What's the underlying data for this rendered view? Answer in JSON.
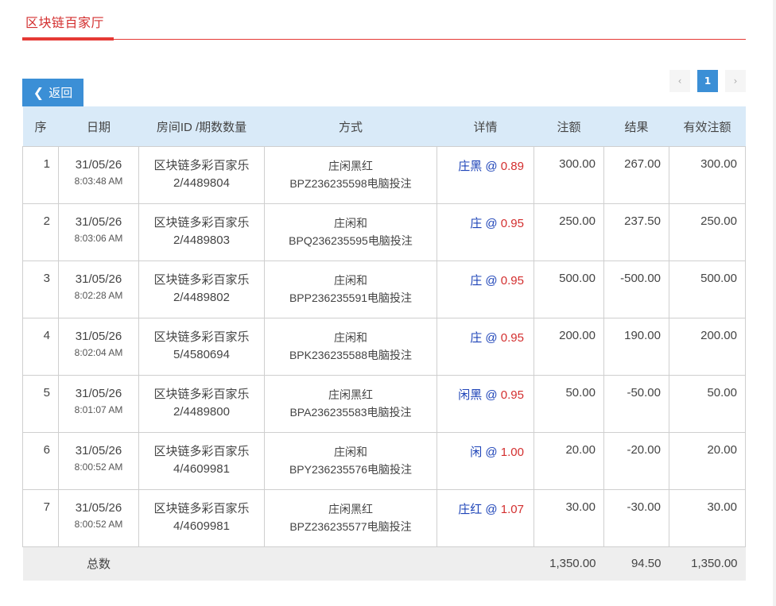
{
  "header": {
    "title": "区块链百家厅"
  },
  "toolbar": {
    "back_label": "返回",
    "back_icon": "chevron-left-icon"
  },
  "pagination": {
    "prev": "‹",
    "current": "1",
    "next": "›"
  },
  "table": {
    "columns": [
      "序",
      "日期",
      "房间ID /期数数量",
      "方式",
      "详情",
      "注额",
      "结果",
      "有效注额"
    ],
    "rows": [
      {
        "seq": "1",
        "date": "31/05/26",
        "time": "8:03:48 AM",
        "room": "区块链多彩百家乐",
        "round": "2/4489804",
        "mode": "庄闲黑红",
        "code": "BPZ236235598电脑投注",
        "selection": "庄黑",
        "at": "@",
        "odds": "0.89",
        "amount": "300.00",
        "result": "267.00",
        "result_sign": "pos",
        "valid": "300.00"
      },
      {
        "seq": "2",
        "date": "31/05/26",
        "time": "8:03:06 AM",
        "room": "区块链多彩百家乐",
        "round": "2/4489803",
        "mode": "庄闲和",
        "code": "BPQ236235595电脑投注",
        "selection": "庄",
        "at": "@",
        "odds": "0.95",
        "amount": "250.00",
        "result": "237.50",
        "result_sign": "pos",
        "valid": "250.00"
      },
      {
        "seq": "3",
        "date": "31/05/26",
        "time": "8:02:28 AM",
        "room": "区块链多彩百家乐",
        "round": "2/4489802",
        "mode": "庄闲和",
        "code": "BPP236235591电脑投注",
        "selection": "庄",
        "at": "@",
        "odds": "0.95",
        "amount": "500.00",
        "result": "-500.00",
        "result_sign": "neg",
        "valid": "500.00"
      },
      {
        "seq": "4",
        "date": "31/05/26",
        "time": "8:02:04 AM",
        "room": "区块链多彩百家乐",
        "round": "5/4580694",
        "mode": "庄闲和",
        "code": "BPK236235588电脑投注",
        "selection": "庄",
        "at": "@",
        "odds": "0.95",
        "amount": "200.00",
        "result": "190.00",
        "result_sign": "pos",
        "valid": "200.00"
      },
      {
        "seq": "5",
        "date": "31/05/26",
        "time": "8:01:07 AM",
        "room": "区块链多彩百家乐",
        "round": "2/4489800",
        "mode": "庄闲黑红",
        "code": "BPA236235583电脑投注",
        "selection": "闲黑",
        "at": "@",
        "odds": "0.95",
        "amount": "50.00",
        "result": "-50.00",
        "result_sign": "neg",
        "valid": "50.00"
      },
      {
        "seq": "6",
        "date": "31/05/26",
        "time": "8:00:52 AM",
        "room": "区块链多彩百家乐",
        "round": "4/4609981",
        "mode": "庄闲和",
        "code": "BPY236235576电脑投注",
        "selection": "闲",
        "at": "@",
        "odds": "1.00",
        "amount": "20.00",
        "result": "-20.00",
        "result_sign": "neg",
        "valid": "20.00"
      },
      {
        "seq": "7",
        "date": "31/05/26",
        "time": "8:00:52 AM",
        "room": "区块链多彩百家乐",
        "round": "4/4609981",
        "mode": "庄闲黑红",
        "code": "BPZ236235577电脑投注",
        "selection": "庄红",
        "at": "@",
        "odds": "1.07",
        "amount": "30.00",
        "result": "-30.00",
        "result_sign": "neg",
        "valid": "30.00"
      }
    ],
    "total": {
      "label": "总数",
      "amount": "1,350.00",
      "result": "94.50",
      "valid": "1,350.00"
    }
  },
  "colors": {
    "accent_red": "#e53935",
    "header_bg": "#d9eaf8",
    "button_blue": "#3b8fd6",
    "win_green": "#2e9e32",
    "lose_red": "#d32f2f",
    "selection_blue": "#1e44b8"
  }
}
